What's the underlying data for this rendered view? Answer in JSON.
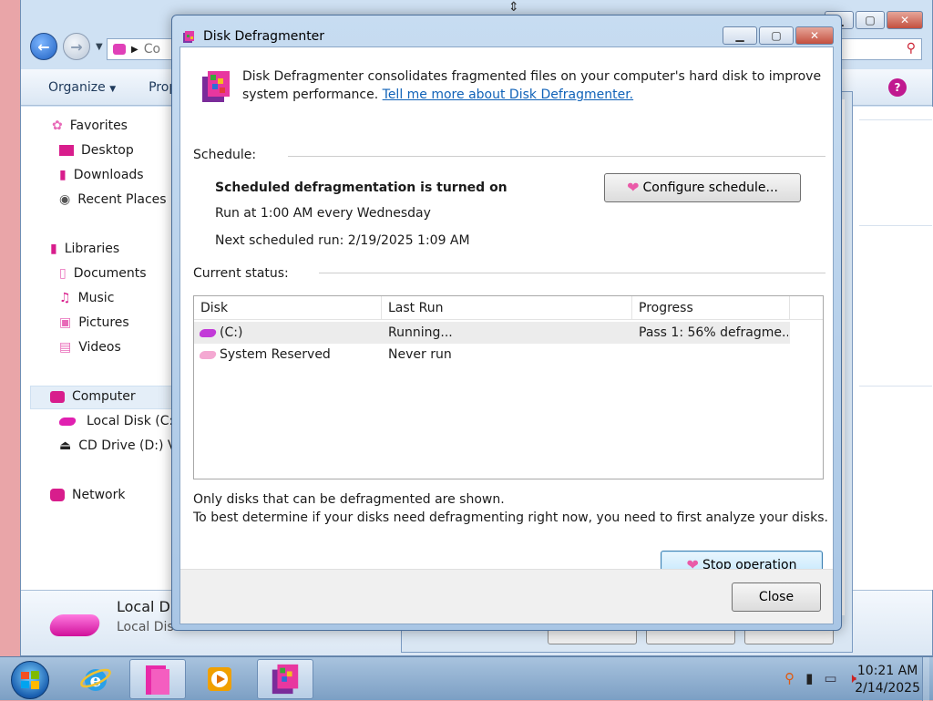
{
  "colors": {
    "accent_pink": "#ea5aa8",
    "link": "#1062b8",
    "title_bar": "#c7dcf1",
    "taskbar": "#8fb0d2",
    "disk_c": "#c23ad8",
    "disk_reserved": "#f4a8d2"
  },
  "dialog": {
    "title": "Disk Defragmenter",
    "title_icon": "defrag-icon",
    "intro_text": "Disk Defragmenter consolidates fragmented files on your computer's hard disk to improve system performance.",
    "intro_link": "Tell me more about Disk Defragmenter.",
    "schedule_label": "Schedule:",
    "schedule_status": "Scheduled defragmentation is turned on",
    "schedule_run": "Run at 1:00 AM every Wednesday",
    "schedule_next": "Next scheduled run: 2/19/2025 1:09 AM",
    "configure_button": "Configure schedule...",
    "current_status_label": "Current status:",
    "table": {
      "columns": [
        "Disk",
        "Last Run",
        "Progress"
      ],
      "rows": [
        {
          "disk": "(C:)",
          "last_run": "Running...",
          "progress": "Pass 1: 56% defragme...",
          "selected": true
        },
        {
          "disk": "System Reserved",
          "last_run": "Never run",
          "progress": "",
          "selected": false
        }
      ]
    },
    "note_line1": "Only disks that can be defragmented are shown.",
    "note_line2": "To best determine if your disks need defragmenting right now, you need to first analyze your disks.",
    "stop_button": "Stop operation",
    "close_button": "Close"
  },
  "explorer": {
    "address_partial": "Co",
    "toolbar": {
      "organize": "Organize",
      "properties_partial": "Prop"
    },
    "sidebar": {
      "favorites": "Favorites",
      "desktop": "Desktop",
      "downloads": "Downloads",
      "recent_places": "Recent Places",
      "libraries": "Libraries",
      "documents": "Documents",
      "music": "Music",
      "pictures": "Pictures",
      "videos": "Videos",
      "computer": "Computer",
      "local_disk": "Local Disk (C:)",
      "cd_drive": "CD Drive (D:) V",
      "network": "Network"
    },
    "details": {
      "title_partial": "Local Di",
      "subtitle_partial": "Local Dis"
    }
  },
  "taskbar": {
    "time": "10:21 AM",
    "date": "2/14/2025",
    "pinned": [
      "internet-explorer-icon",
      "libraries-folder-icon",
      "media-player-icon",
      "disk-defragmenter-icon"
    ]
  }
}
